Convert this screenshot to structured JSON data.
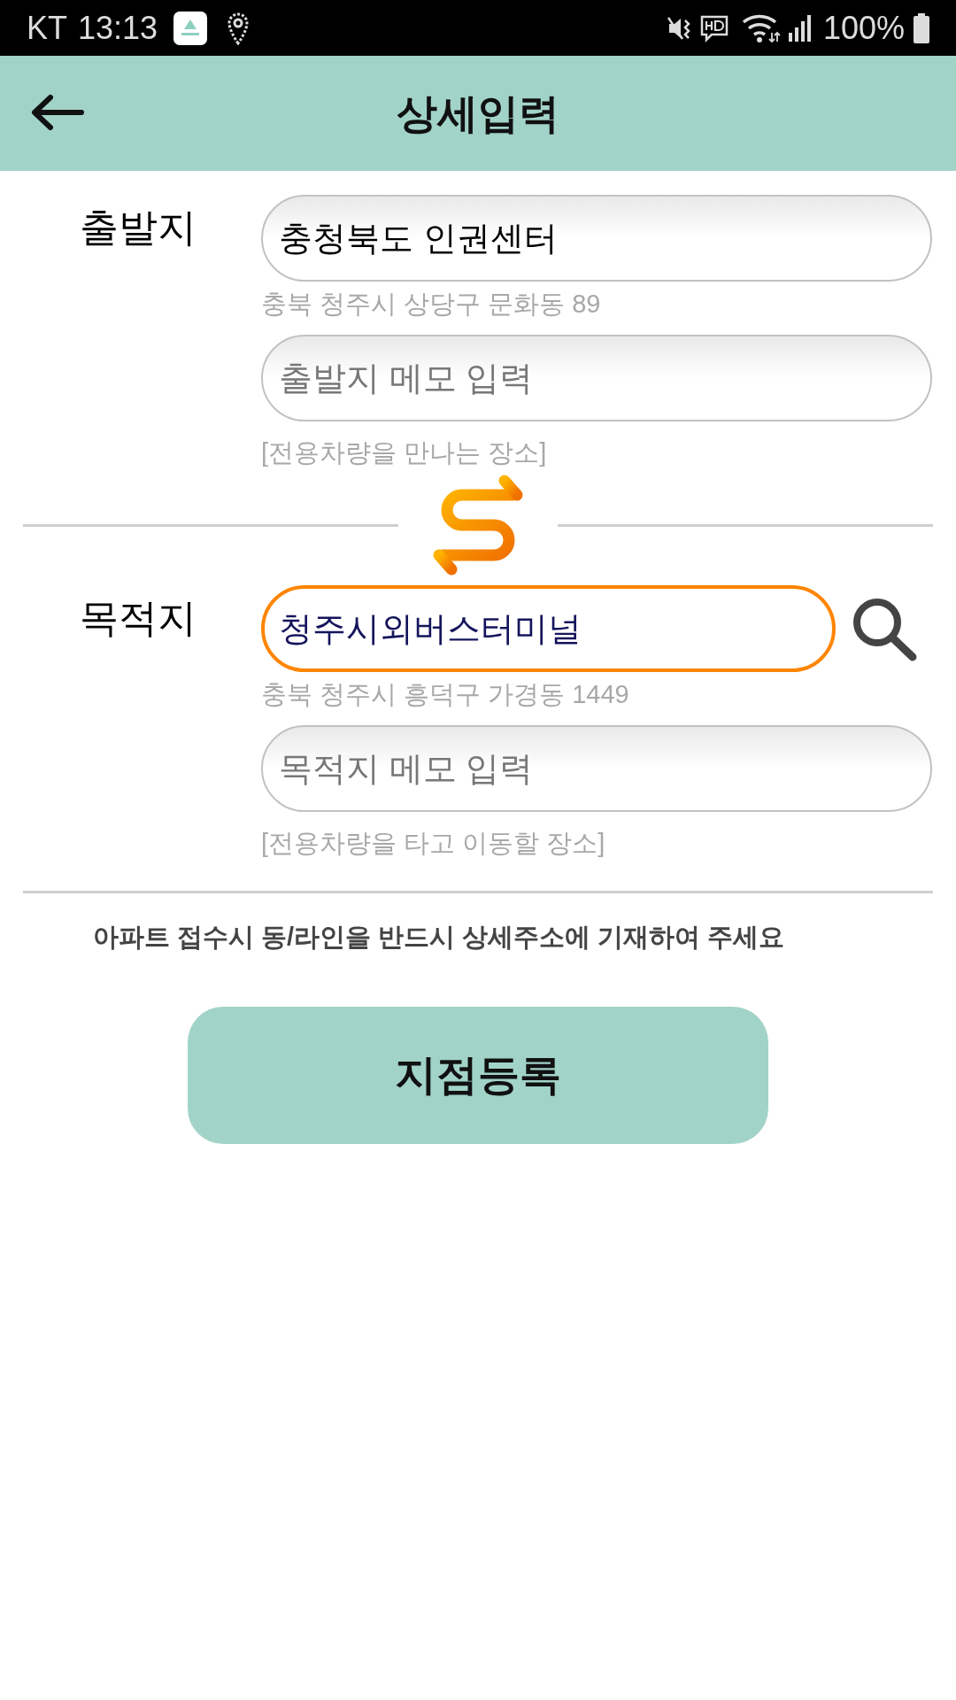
{
  "status_bar": {
    "carrier": "KT",
    "time": "13:13",
    "battery": "100%"
  },
  "header": {
    "title": "상세입력"
  },
  "places": [
    {
      "label": "출발지",
      "value": "충청북도 인권센터",
      "focused": false,
      "search": false,
      "address": "충북 청주시 상당구 문화동 89",
      "memo_placeholder": "출발지 메모 입력",
      "hint": "[전용차량을 만나는 장소]"
    },
    {
      "label": "목적지",
      "value": "청주시외버스터미널",
      "focused": true,
      "search": true,
      "address": "충북 청주시 흥덕구 가경동 1449",
      "memo_placeholder": "목적지 메모 입력",
      "hint": "[전용차량을 타고 이동할 장소]"
    }
  ],
  "notice": "아파트 접수시 동/라인을 반드시 상세주소에 기재하여 주세요",
  "submit_button": {
    "label": "지점등록"
  }
}
